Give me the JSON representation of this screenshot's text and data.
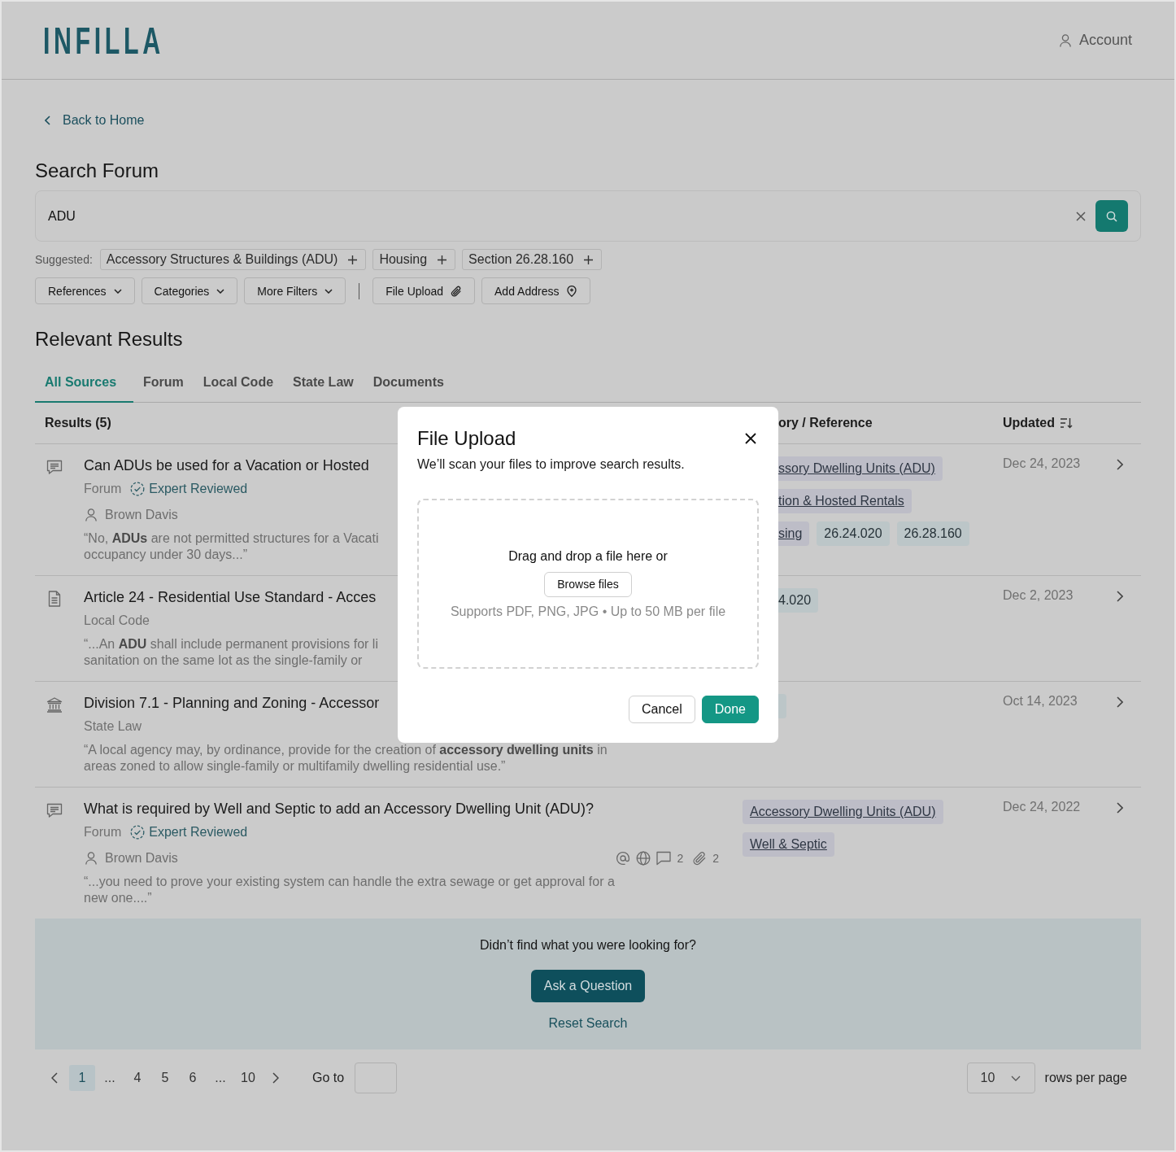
{
  "header": {
    "logo": "INFILLA",
    "account": "Account"
  },
  "back_link": "Back to Home",
  "search": {
    "title": "Search Forum",
    "value": "ADU"
  },
  "suggested": {
    "label": "Suggested:",
    "items": [
      "Accessory Structures & Buildings (ADU)",
      "Housing",
      "Section 26.28.160"
    ]
  },
  "filters": [
    {
      "kind": "dropdown",
      "label": "References"
    },
    {
      "kind": "dropdown",
      "label": "Categories"
    },
    {
      "kind": "dropdown",
      "label": "More Filters"
    },
    {
      "kind": "divider"
    },
    {
      "kind": "upload",
      "label": "File Upload"
    },
    {
      "kind": "address",
      "label": "Add Address"
    }
  ],
  "results": {
    "title": "Relevant Results",
    "tabs": [
      {
        "label": "All Sources",
        "selected": true
      },
      {
        "label": "Forum",
        "selected": false
      },
      {
        "label": "Local Code",
        "selected": false
      },
      {
        "label": "State Law",
        "selected": false
      },
      {
        "label": "Documents",
        "selected": false
      }
    ],
    "columns": [
      {
        "label": "Results (5)",
        "sorted": false
      },
      {
        "label": "ory / Reference",
        "sorted": false
      },
      {
        "label": "Updated",
        "sorted": true
      }
    ],
    "rows": [
      {
        "kind": "forum",
        "title": "Can ADUs be used for a Vacation or Hosted",
        "source": "Forum",
        "badge": "Expert Reviewed",
        "author": "Brown Davis",
        "excerpt": "“No, **ADUs** are not permitted structures for a Vacati\noccupancy under 30 days...”",
        "tags": [
          {
            "kind": "category",
            "text": "ssory Dwelling Units (ADU)",
            "cut_off": true
          },
          {
            "kind": "category",
            "text": "tion & Hosted Rentals",
            "cut_off": true
          },
          {
            "kind": "category",
            "text": "sing",
            "cut_off": true
          },
          {
            "kind": "reference",
            "text": "26.24.020",
            "cut_off": false
          },
          {
            "kind": "reference",
            "text": "26.28.160",
            "cut_off": false
          }
        ],
        "date": "Dec 24, 2023"
      },
      {
        "kind": "local_code",
        "title": "Article 24 - Residential Use Standard - Acces",
        "source": "Local Code",
        "excerpt": "“...An **ADU** shall include permanent provisions for li\nsanitation on the same lot as the single-family or",
        "tags": [
          {
            "kind": "reference",
            "text": "4.020",
            "cut_off": true
          }
        ],
        "date": "Dec 2, 2023"
      },
      {
        "kind": "state_law",
        "title": "Division 7.1 - Planning and Zoning - Accessor",
        "source": "State Law",
        "excerpt": "“A local agency may, by ordinance, provide for the creation of **accessory dwelling units** in\nareas zoned to allow single-family or multifamily dwelling residential use.”",
        "tags": [
          {
            "kind": "reference",
            "cut_off": true
          }
        ],
        "date": "Oct 14, 2023"
      },
      {
        "kind": "forum",
        "title": "What is required by Well and Septic to add an Accessory Dwelling Unit (ADU)?",
        "source": "Forum",
        "badge": "Expert Reviewed",
        "author": "Brown Davis",
        "stats": [
          {
            "kind": "mention"
          },
          {
            "kind": "web"
          },
          {
            "kind": "comments",
            "count": "2"
          },
          {
            "kind": "attachments",
            "count": "2"
          }
        ],
        "excerpt": "“...you need to prove your existing system can handle the extra sewage or get approval for a\nnew one....”",
        "tags": [
          {
            "kind": "category",
            "text": "Accessory Dwelling Units (ADU)",
            "cut_off": false
          },
          {
            "kind": "category",
            "text": "Well & Septic",
            "cut_off": false
          }
        ],
        "date": "Dec 24, 2022"
      }
    ]
  },
  "banner": {
    "text": "Didn’t find what you were looking for?",
    "button": "Ask a Question",
    "link": "Reset Search"
  },
  "pagination": {
    "items": [
      {
        "kind": "prev"
      },
      {
        "kind": "page",
        "label": "1",
        "selected": true
      },
      {
        "kind": "gap",
        "label": "..."
      },
      {
        "kind": "page",
        "label": "4",
        "selected": false
      },
      {
        "kind": "page",
        "label": "5",
        "selected": false
      },
      {
        "kind": "page",
        "label": "6",
        "selected": false
      },
      {
        "kind": "gap",
        "label": "..."
      },
      {
        "kind": "page",
        "label": "10",
        "selected": false
      },
      {
        "kind": "next"
      }
    ],
    "goto_label": "Go to",
    "rows_per_page": {
      "value": "10",
      "label": "rows per page"
    }
  },
  "modal": {
    "title": "File Upload",
    "subtitle": "We’ll scan your files to improve search results.",
    "dropzone": {
      "text": "Drag and drop a file here or",
      "button": "Browse files",
      "hint": "Supports PDF, PNG, JPG • Up to 50 MB per file"
    },
    "buttons": [
      {
        "kind": "secondary",
        "label": "Cancel"
      },
      {
        "kind": "primary",
        "label": "Done"
      }
    ]
  }
}
